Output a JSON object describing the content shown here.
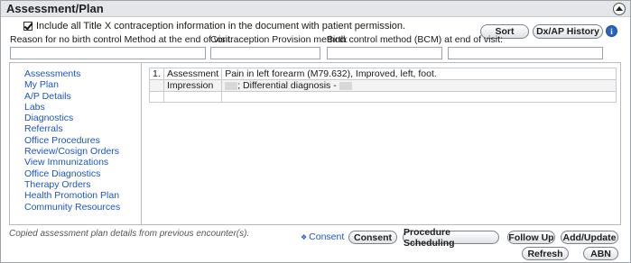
{
  "section": {
    "title": "Assessment/Plan"
  },
  "consent_checkbox": {
    "label": "Include all Title X contraception information in the document with patient permission.",
    "checked": true
  },
  "toolbar": {
    "sort_label": "Sort",
    "dxap_history_label": "Dx/AP History",
    "info_label": "i"
  },
  "fields": [
    {
      "label": "Reason for no birth control Method at the end of visit:",
      "value": ""
    },
    {
      "label": "Contraception Provision method:",
      "value": ""
    },
    {
      "label": "Birth control method (BCM) at end of visit:",
      "value": ""
    }
  ],
  "nav": {
    "items": [
      "Assessments",
      "My Plan",
      "A/P Details",
      "Labs",
      "Diagnostics",
      "Referrals",
      "Office Procedures",
      "Review/Cosign Orders",
      "View Immunizations",
      "Office Diagnostics",
      "Therapy Orders",
      "Health Promotion Plan",
      "Community Resources"
    ]
  },
  "assessment_table": {
    "rows": [
      {
        "num": "1.",
        "type": "Assessment",
        "text": "Pain in left forearm (M79.632), Improved, left, foot."
      },
      {
        "num": "",
        "type": "Impression",
        "text": "; Differential diagnosis -"
      },
      {
        "num": "",
        "type": "",
        "text": ""
      }
    ]
  },
  "footer": {
    "note": "Copied assessment plan details from previous encounter(s).",
    "consent_link": "Consent",
    "buttons": {
      "consent": "Consent",
      "procedure_scheduling": "Procedure Scheduling",
      "follow_up": "Follow Up",
      "add_update": "Add/Update",
      "refresh": "Refresh",
      "abn": "ABN"
    }
  },
  "colors": {
    "link": "#1c55c4",
    "header_bg": "#e4e6e9",
    "info_icon": "#2a63b8"
  },
  "icons": {
    "collapse": "chevron-up-icon",
    "info": "info-icon",
    "consent_link": "chevron-right-icon"
  }
}
